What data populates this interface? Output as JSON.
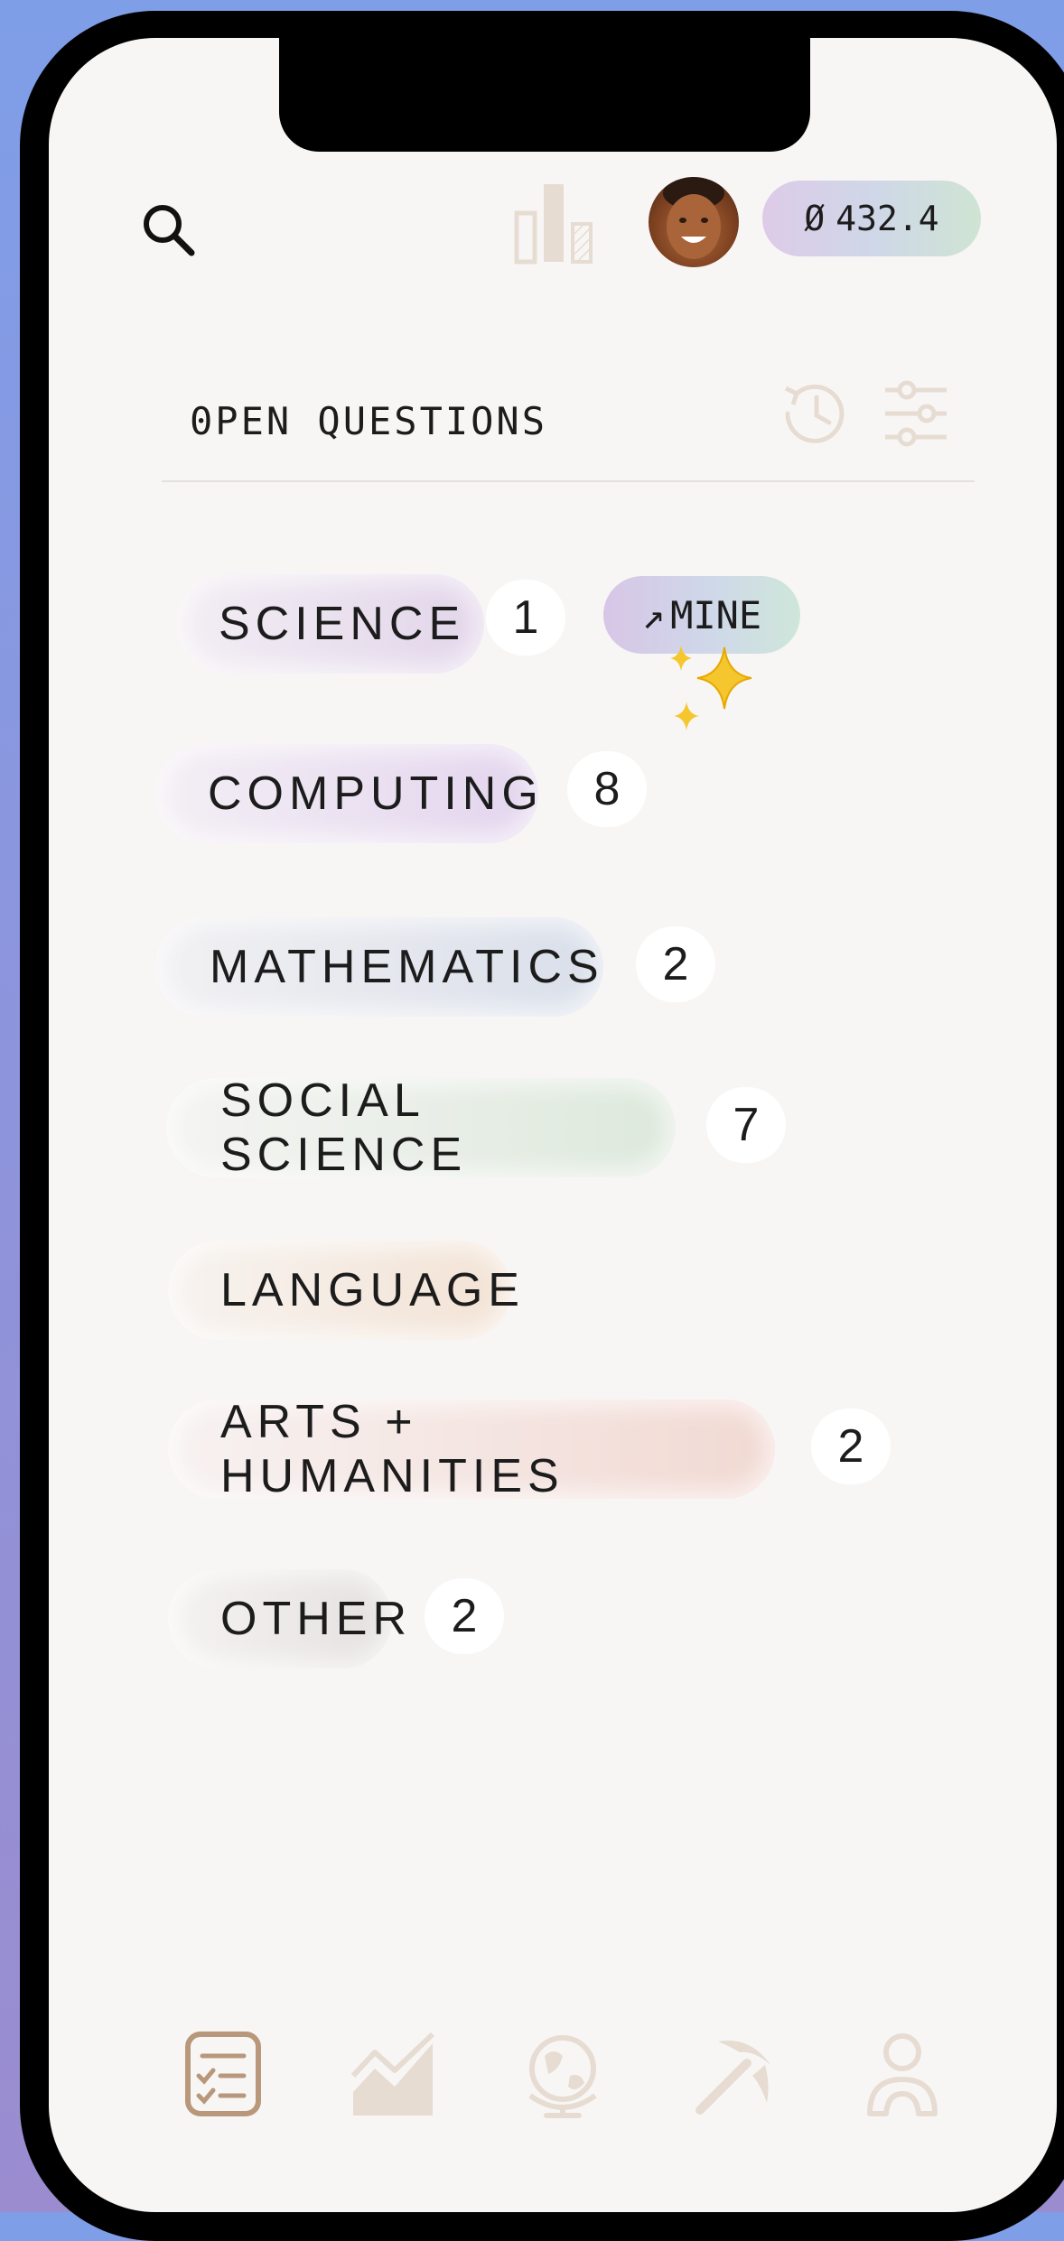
{
  "header": {
    "balance_symbol": "Ø",
    "balance_value": "432.4"
  },
  "section": {
    "title": "0PEN QUESTIONS"
  },
  "categories": [
    {
      "label": "SCIENCE",
      "count": "1",
      "tag": "MINE",
      "tag_icon": "pickaxe-arrow-icon"
    },
    {
      "label": "COMPUTING",
      "count": "8"
    },
    {
      "label": "MATHEMATICS",
      "count": "2"
    },
    {
      "label": "SOCIAL SCIENCE",
      "count": "7"
    },
    {
      "label": "LANGUAGE"
    },
    {
      "label": "ARTS + HUMANITIES",
      "count": "2"
    },
    {
      "label": "OTHER",
      "count": "2"
    }
  ],
  "colors": {
    "background": "#f8f6f5",
    "science": "#e2d5ea",
    "computing": "#e3d5ee",
    "mathematics": "#d9dfea",
    "social_science": "#dde9dc",
    "language": "#f3e3d5",
    "arts_humanities": "#f2d9d3",
    "other": "#e4e1df",
    "icon_muted": "#e6dcd2",
    "icon_active": "#b8977a"
  },
  "bottom_nav": [
    {
      "icon": "questions-checklist-icon",
      "active": true
    },
    {
      "icon": "trending-chart-icon",
      "active": false
    },
    {
      "icon": "globe-icon",
      "active": false
    },
    {
      "icon": "pickaxe-icon",
      "active": false
    },
    {
      "icon": "profile-icon",
      "active": false
    }
  ]
}
